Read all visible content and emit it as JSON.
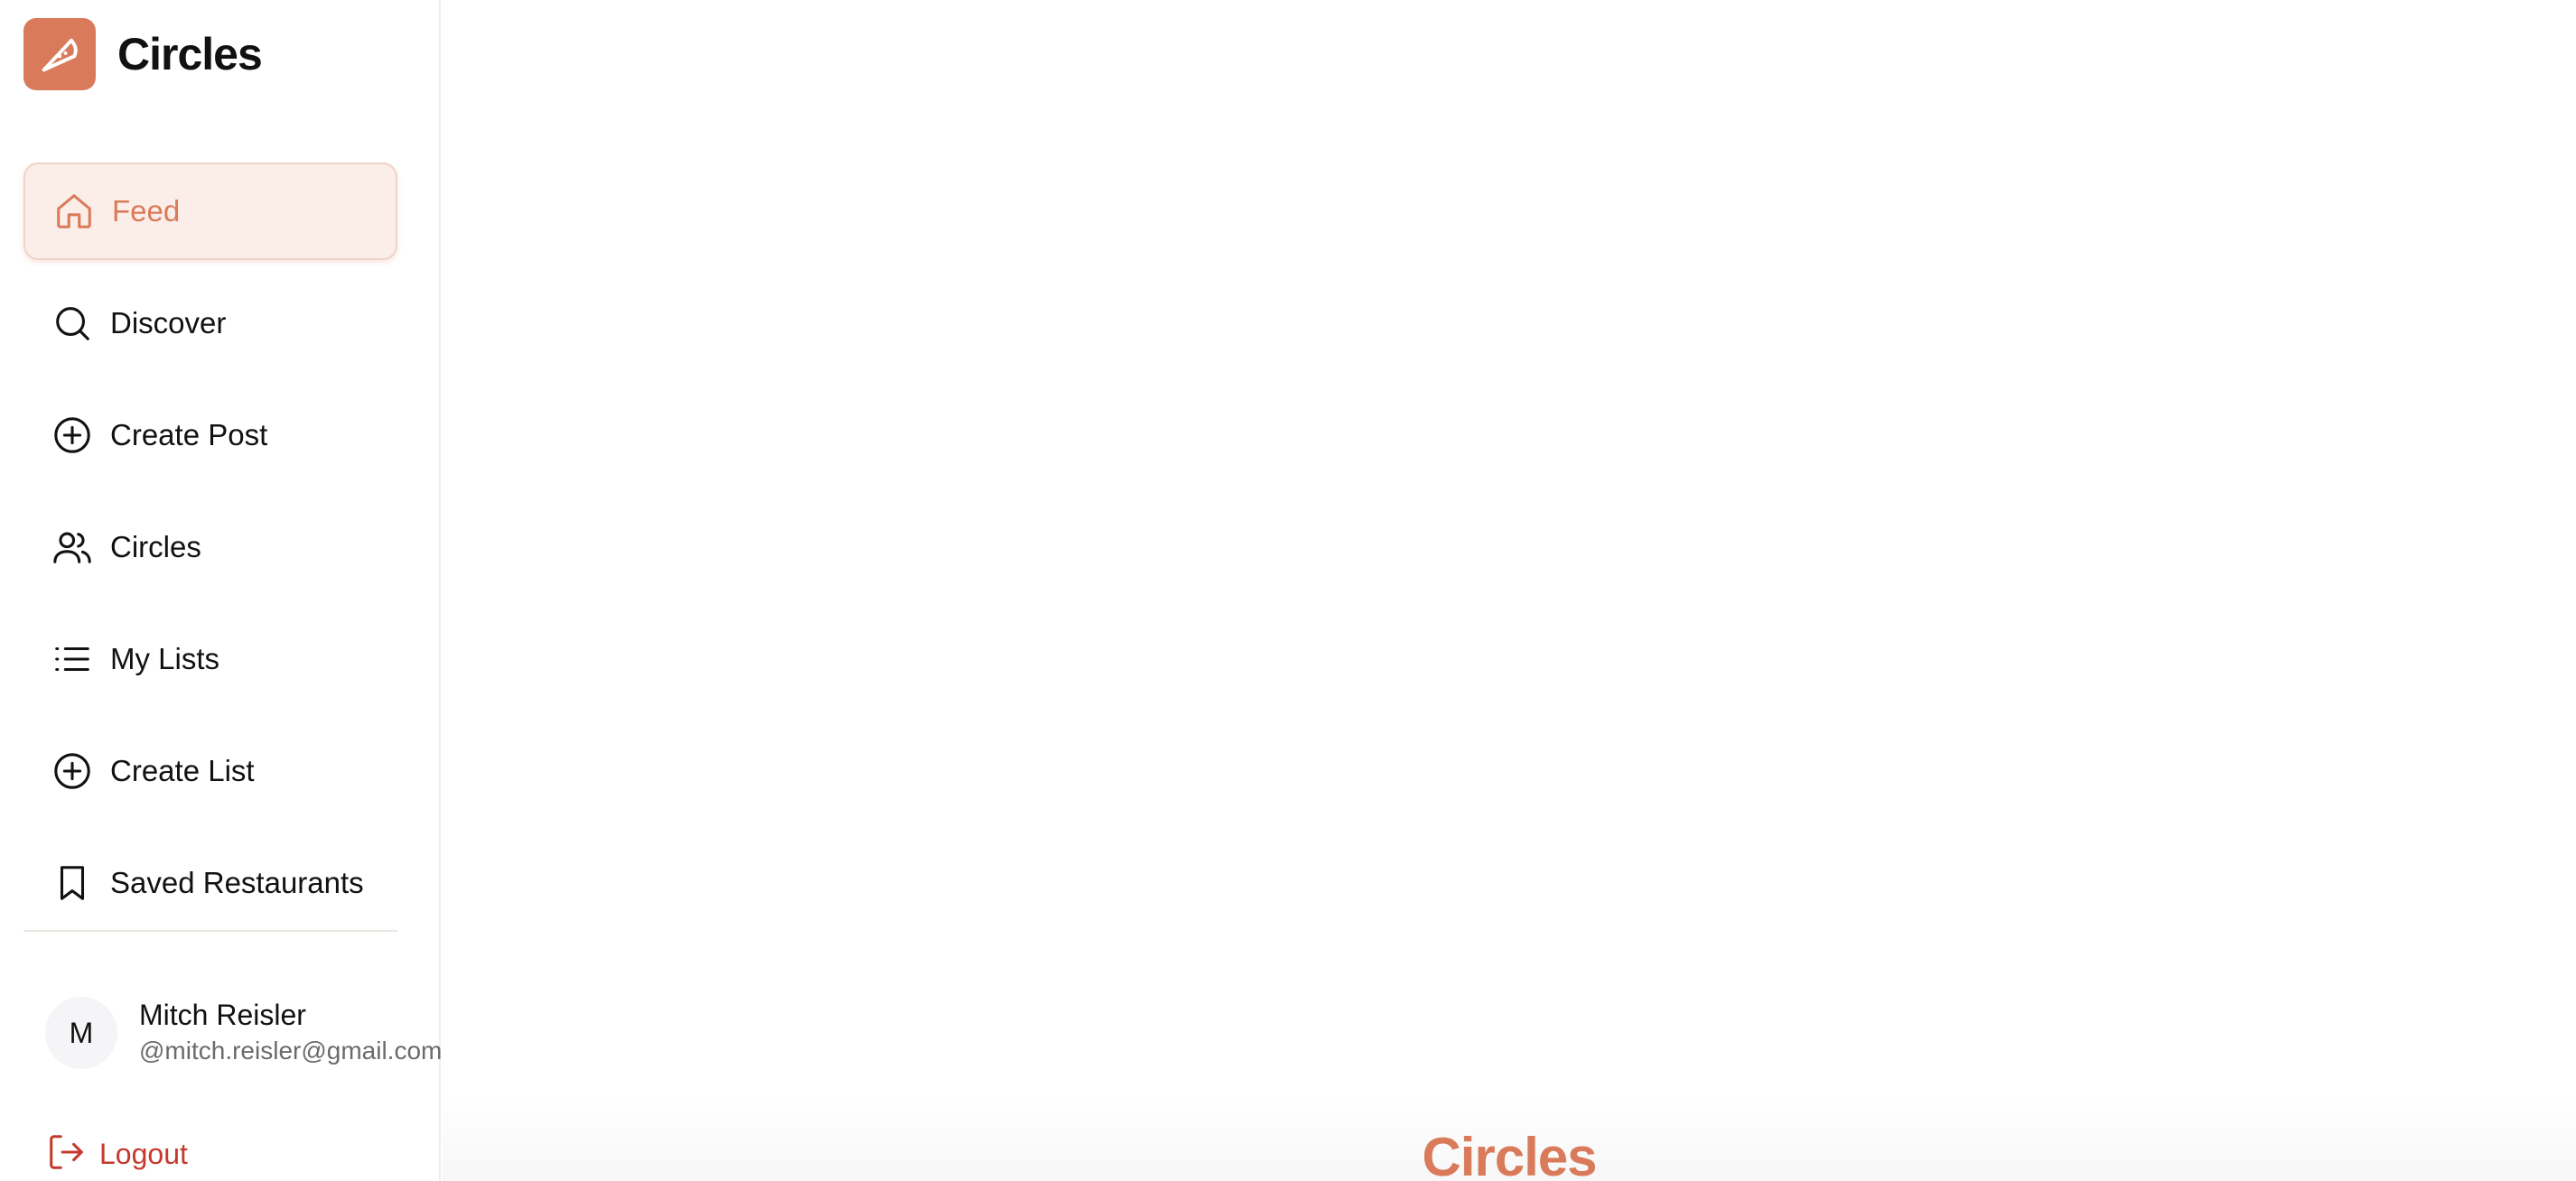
{
  "brand": {
    "name": "Circles",
    "logo_icon": "pizza-slice-icon",
    "accent_color": "#d97b5a"
  },
  "sidebar": {
    "items": [
      {
        "label": "Feed",
        "icon": "home-icon",
        "active": true
      },
      {
        "label": "Discover",
        "icon": "search-icon"
      },
      {
        "label": "Create Post",
        "icon": "plus-circle-icon"
      },
      {
        "label": "Circles",
        "icon": "users-icon"
      },
      {
        "label": "My Lists",
        "icon": "list-icon"
      },
      {
        "label": "Create List",
        "icon": "plus-circle-icon"
      },
      {
        "label": "Saved Restaurants",
        "icon": "bookmark-icon"
      }
    ]
  },
  "user": {
    "initial": "M",
    "name": "Mitch Reisler",
    "email": "@mitch.reisler@gmail.com"
  },
  "logout": {
    "label": "Logout",
    "color": "#c53a2e"
  },
  "footer": {
    "brand": "Circles"
  }
}
